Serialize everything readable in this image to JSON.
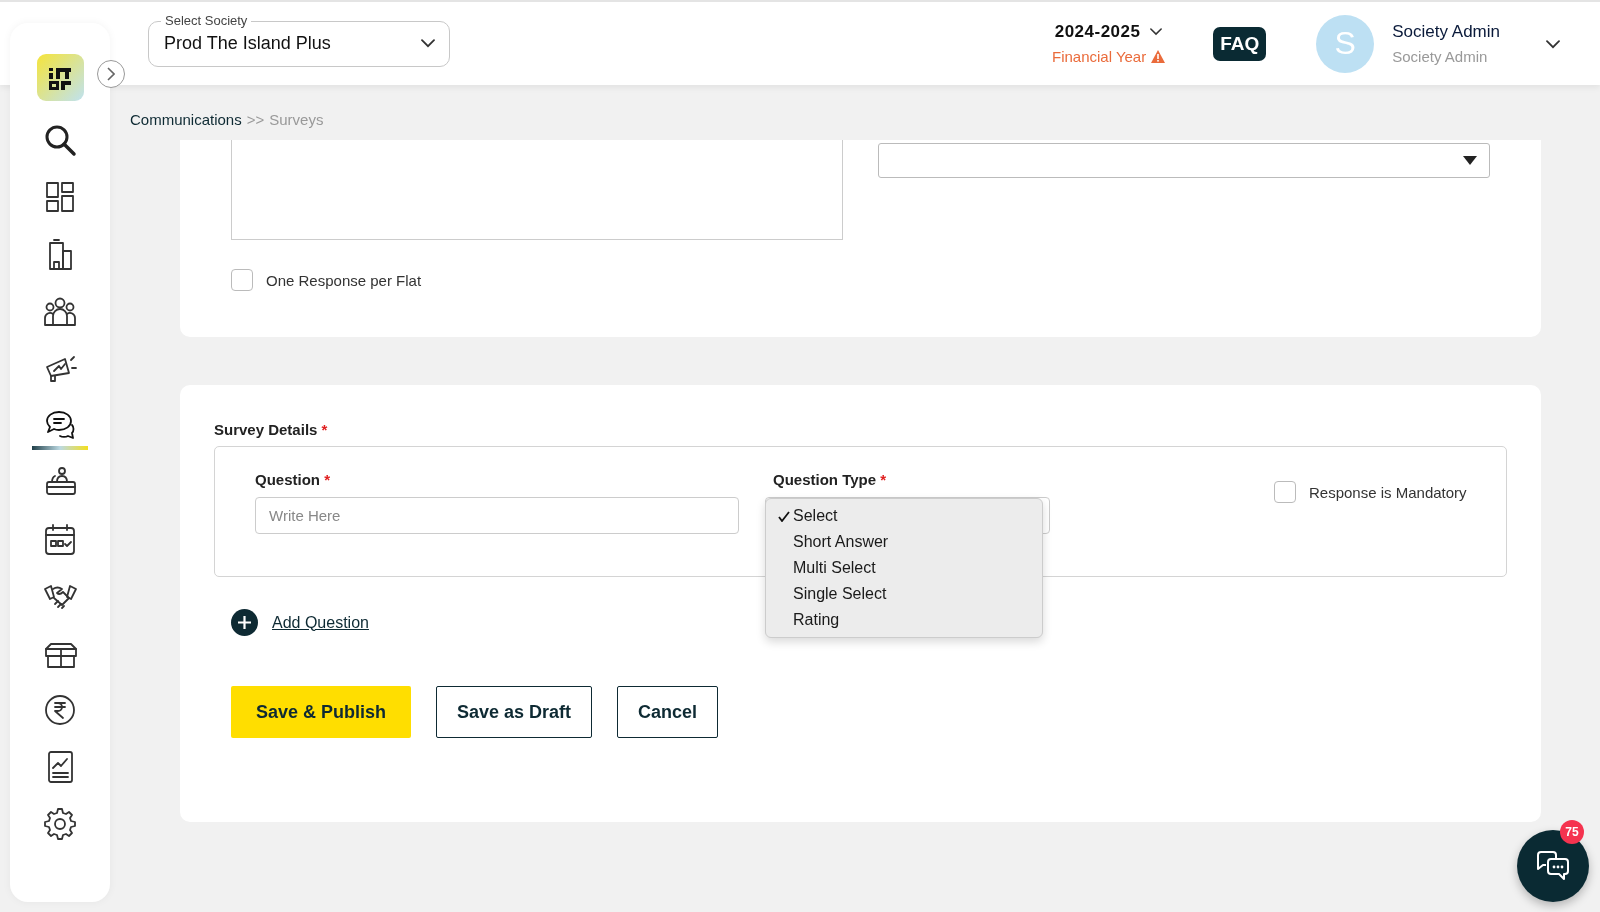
{
  "header": {
    "society_select": {
      "label": "Select Society",
      "value": "Prod The Island Plus"
    },
    "year": {
      "value": "2024-2025",
      "caption": "Financial Year"
    },
    "faq": "FAQ",
    "user": {
      "initial": "S",
      "name": "Society Admin",
      "role": "Society Admin"
    }
  },
  "sidebar": {
    "items": [
      {
        "selected": false
      },
      {
        "selected": false
      },
      {
        "selected": false
      },
      {
        "selected": false
      },
      {
        "selected": false
      },
      {
        "selected": true
      },
      {
        "selected": false
      },
      {
        "selected": false
      },
      {
        "selected": false
      },
      {
        "selected": false
      },
      {
        "selected": false
      },
      {
        "selected": false
      },
      {
        "selected": false
      }
    ]
  },
  "breadcrumb": {
    "parent": "Communications",
    "separator": ">>",
    "current": "Surveys"
  },
  "settings_card": {
    "one_response_per_flat": {
      "label": "One Response per Flat",
      "checked": false
    }
  },
  "survey_details": {
    "title": "Survey Details",
    "required_mark": "*",
    "question": {
      "label": "Question",
      "required_mark": "*",
      "placeholder": "Write Here"
    },
    "question_type": {
      "label": "Question Type",
      "required_mark": "*",
      "options": [
        {
          "label": "Select",
          "selected": true
        },
        {
          "label": "Short Answer",
          "selected": false
        },
        {
          "label": "Multi Select",
          "selected": false
        },
        {
          "label": "Single Select",
          "selected": false
        },
        {
          "label": "Rating",
          "selected": false
        }
      ]
    },
    "response_mandatory": {
      "label": "Response is Mandatory",
      "checked": false
    },
    "add_question": "Add Question"
  },
  "buttons": [
    {
      "label": "Save & Publish",
      "kind": "primary"
    },
    {
      "label": "Save as Draft",
      "kind": "outline"
    },
    {
      "label": "Cancel",
      "kind": "outline"
    }
  ],
  "chat": {
    "badge": "75"
  }
}
